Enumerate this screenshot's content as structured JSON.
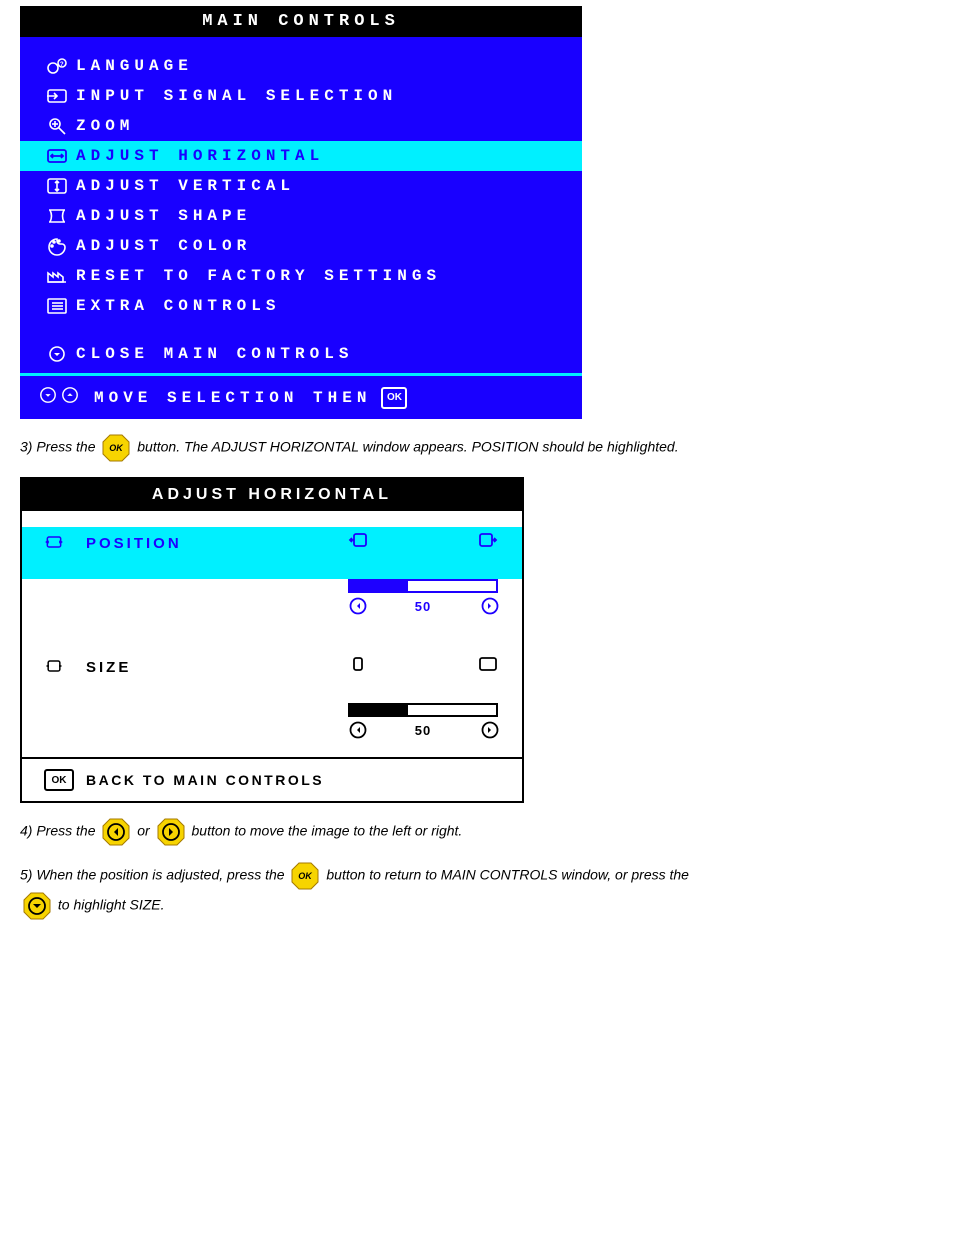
{
  "osd1": {
    "title": "MAIN CONTROLS",
    "items": [
      {
        "label": "LANGUAGE"
      },
      {
        "label": "INPUT SIGNAL SELECTION"
      },
      {
        "label": "ZOOM"
      },
      {
        "label": "ADJUST HORIZONTAL"
      },
      {
        "label": "ADJUST VERTICAL"
      },
      {
        "label": "ADJUST SHAPE"
      },
      {
        "label": "ADJUST COLOR"
      },
      {
        "label": "RESET TO FACTORY SETTINGS"
      },
      {
        "label": "EXTRA CONTROLS"
      }
    ],
    "close": "CLOSE MAIN CONTROLS",
    "hint": "MOVE SELECTION THEN",
    "ok": "OK"
  },
  "osd2": {
    "title": "ADJUST HORIZONTAL",
    "position": {
      "label": "POSITION",
      "value": "50"
    },
    "size": {
      "label": "SIZE",
      "value": "50"
    },
    "back": "BACK TO MAIN CONTROLS",
    "ok": "OK"
  },
  "steps": {
    "s3a": "3) Press the ",
    "s3b": " button. The ADJUST HORIZONTAL window appears. POSITION should be highlighted.",
    "s4a": "4) Press the ",
    "s4b": " or ",
    "s4c": " button to move the image to the left or right.",
    "s5a": "5) When the position is adjusted, press the ",
    "s5b": " button to return to MAIN CONTROLS window, or press the",
    "s5c": "to highlight SIZE."
  }
}
